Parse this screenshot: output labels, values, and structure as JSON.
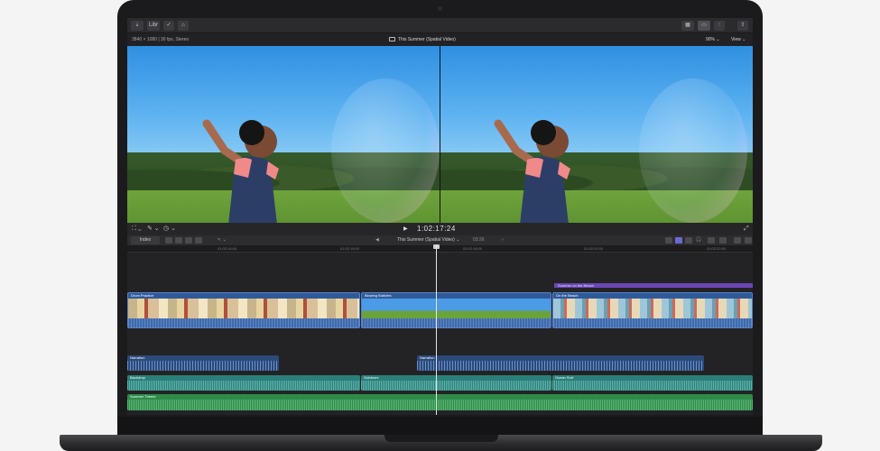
{
  "toolbar": {
    "import_label": "⇣",
    "library_label": "Libr",
    "check_label": "✓",
    "key_label": "⌂"
  },
  "viewer_info": {
    "format": "3840 × 1080 | 30 fps, Stereo",
    "project_title": "This Summer (Spatial Video)",
    "zoom": "90% ⌄",
    "view": "View ⌄"
  },
  "transport": {
    "timecode": "1:02:17:24"
  },
  "timeline_bar": {
    "index_label": "Index",
    "project": "This Summer (Spatial Video) ⌄",
    "duration": "03:26"
  },
  "ruler": {
    "ticks": [
      "01:02:14:00",
      "01:02:16:00",
      "01:02:18:00",
      "01:02:20:00",
      "01:02:22:00"
    ]
  },
  "timeline": {
    "title_clip": "Summer on the Beach",
    "video_clips": [
      "Drum Practice",
      "Blowing Bubbles",
      "On the Beach"
    ],
    "narration_labels": [
      "Narration",
      "Narration"
    ],
    "ambience_labels": [
      "Backdrop",
      "Outdoors",
      "Ocean Surf"
    ],
    "music_label": "Summer Theme"
  },
  "colors": {
    "video_clip": "#2f5a9a",
    "narration": "#2a4a7a",
    "ambience": "#2b7f7a",
    "music": "#2f8a4a",
    "title": "#6b46b6"
  }
}
